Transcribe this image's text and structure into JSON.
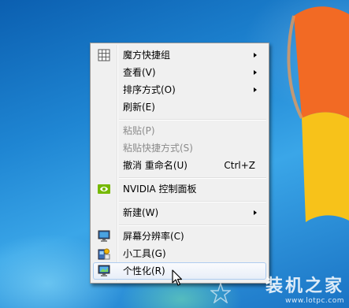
{
  "menu": {
    "items": [
      {
        "label": "魔方快捷组",
        "shortcut": "",
        "submenu": true,
        "disabled": false,
        "icon": "grid-icon"
      },
      {
        "label": "查看(V)",
        "shortcut": "",
        "submenu": true,
        "disabled": false,
        "icon": ""
      },
      {
        "label": "排序方式(O)",
        "shortcut": "",
        "submenu": true,
        "disabled": false,
        "icon": ""
      },
      {
        "label": "刷新(E)",
        "shortcut": "",
        "submenu": false,
        "disabled": false,
        "icon": ""
      },
      {
        "label": "粘贴(P)",
        "shortcut": "",
        "submenu": false,
        "disabled": true,
        "icon": ""
      },
      {
        "label": "粘贴快捷方式(S)",
        "shortcut": "",
        "submenu": false,
        "disabled": true,
        "icon": ""
      },
      {
        "label": "撤消 重命名(U)",
        "shortcut": "Ctrl+Z",
        "submenu": false,
        "disabled": false,
        "icon": ""
      },
      {
        "label": "NVIDIA 控制面板",
        "shortcut": "",
        "submenu": false,
        "disabled": false,
        "icon": "nvidia-icon"
      },
      {
        "label": "新建(W)",
        "shortcut": "",
        "submenu": true,
        "disabled": false,
        "icon": ""
      },
      {
        "label": "屏幕分辨率(C)",
        "shortcut": "",
        "submenu": false,
        "disabled": false,
        "icon": "monitor-icon"
      },
      {
        "label": "小工具(G)",
        "shortcut": "",
        "submenu": false,
        "disabled": false,
        "icon": "gadgets-icon"
      },
      {
        "label": "个性化(R)",
        "shortcut": "",
        "submenu": false,
        "disabled": false,
        "icon": "personalize-icon",
        "hovered": true
      }
    ]
  },
  "watermark": {
    "text": "装机之家",
    "url": "www.lotpc.com"
  },
  "colors": {
    "menu_bg": "#f0f0f0",
    "hover_border": "#aeccf0",
    "disabled_text": "#8b8b8b"
  }
}
